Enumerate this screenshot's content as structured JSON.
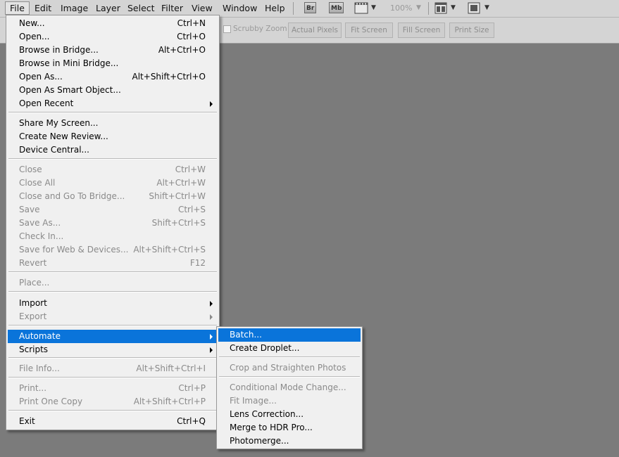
{
  "menubar": {
    "items": [
      "File",
      "Edit",
      "Image",
      "Layer",
      "Select",
      "Filter",
      "View",
      "Window",
      "Help"
    ],
    "bridge_badge": "Br",
    "minibridge_badge": "Mb",
    "zoom": "100%"
  },
  "options_bar": {
    "scrubby_zoom": "Scrubby Zoom",
    "actual_pixels": "Actual Pixels",
    "fit_screen": "Fit Screen",
    "fill_screen": "Fill Screen",
    "print_size": "Print Size"
  },
  "file_menu": {
    "items": [
      {
        "label": "New...",
        "shortcut": "Ctrl+N"
      },
      {
        "label": "Open...",
        "shortcut": "Ctrl+O"
      },
      {
        "label": "Browse in Bridge...",
        "shortcut": "Alt+Ctrl+O"
      },
      {
        "label": "Browse in Mini Bridge..."
      },
      {
        "label": "Open As...",
        "shortcut": "Alt+Shift+Ctrl+O"
      },
      {
        "label": "Open As Smart Object..."
      },
      {
        "label": "Open Recent",
        "submenu": true
      },
      {
        "label": "Share My Screen..."
      },
      {
        "label": "Create New Review..."
      },
      {
        "label": "Device Central..."
      },
      {
        "label": "Close",
        "shortcut": "Ctrl+W",
        "disabled": true
      },
      {
        "label": "Close All",
        "shortcut": "Alt+Ctrl+W",
        "disabled": true
      },
      {
        "label": "Close and Go To Bridge...",
        "shortcut": "Shift+Ctrl+W",
        "disabled": true
      },
      {
        "label": "Save",
        "shortcut": "Ctrl+S",
        "disabled": true
      },
      {
        "label": "Save As...",
        "shortcut": "Shift+Ctrl+S",
        "disabled": true
      },
      {
        "label": "Check In...",
        "disabled": true
      },
      {
        "label": "Save for Web & Devices...",
        "shortcut": "Alt+Shift+Ctrl+S",
        "disabled": true
      },
      {
        "label": "Revert",
        "shortcut": "F12",
        "disabled": true
      },
      {
        "label": "Place...",
        "disabled": true
      },
      {
        "label": "Import",
        "submenu": true
      },
      {
        "label": "Export",
        "submenu": true,
        "disabled": true
      },
      {
        "label": "Automate",
        "submenu": true,
        "highlighted": true
      },
      {
        "label": "Scripts",
        "submenu": true
      },
      {
        "label": "File Info...",
        "shortcut": "Alt+Shift+Ctrl+I",
        "disabled": true
      },
      {
        "label": "Print...",
        "shortcut": "Ctrl+P",
        "disabled": true
      },
      {
        "label": "Print One Copy",
        "shortcut": "Alt+Shift+Ctrl+P",
        "disabled": true
      },
      {
        "label": "Exit",
        "shortcut": "Ctrl+Q"
      }
    ]
  },
  "automate_menu": {
    "items": [
      {
        "label": "Batch...",
        "highlighted": true
      },
      {
        "label": "Create Droplet..."
      },
      {
        "label": "Crop and Straighten Photos",
        "disabled": true
      },
      {
        "label": "Conditional Mode Change...",
        "disabled": true
      },
      {
        "label": "Fit Image...",
        "disabled": true
      },
      {
        "label": "Lens Correction..."
      },
      {
        "label": "Merge to HDR Pro..."
      },
      {
        "label": "Photomerge..."
      }
    ]
  },
  "colors": {
    "highlight": "#0a74da",
    "canvas": "#7b7b7b",
    "menu_bg": "#f0f0f0",
    "disabled_text": "#8a8a8a"
  }
}
